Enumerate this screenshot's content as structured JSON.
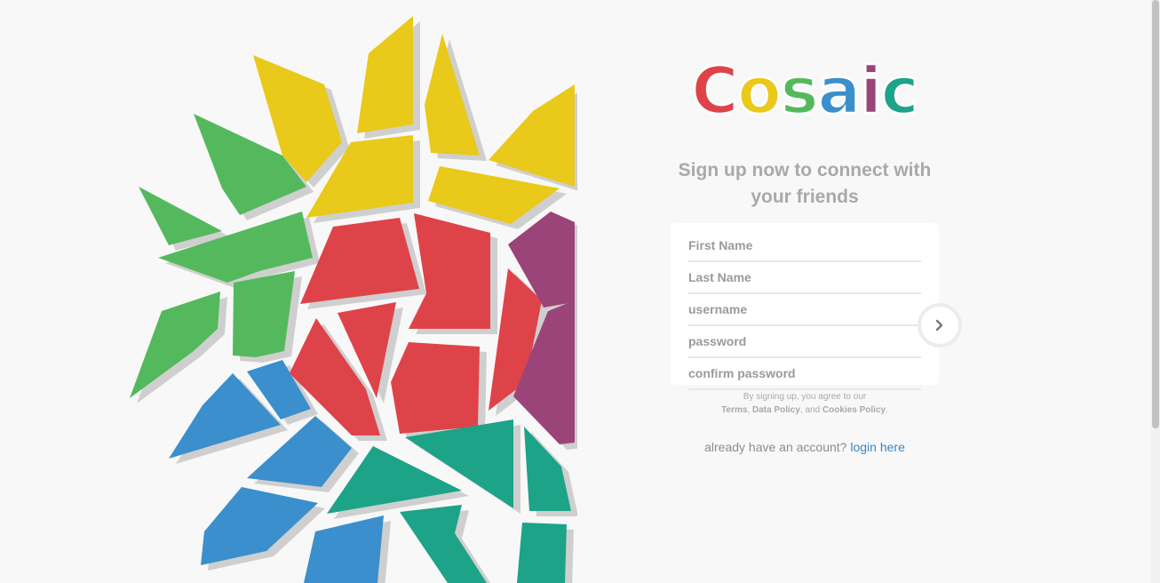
{
  "brand": {
    "name": "Cosaic",
    "letter_colors": [
      "#df434a",
      "#e9c919",
      "#54b95d",
      "#3a8fcc",
      "#9b4479",
      "#1da387"
    ]
  },
  "signup": {
    "tagline_line1": "Sign up now to connect with",
    "tagline_line2": "your friends",
    "fields": {
      "first_name": "First Name",
      "last_name": "Last Name",
      "username": "username",
      "password": "password",
      "confirm_password": "confirm password"
    },
    "submit_icon": "chevron-right-icon",
    "terms": {
      "prefix": "By signing up, you agree to our",
      "terms": "Terms",
      "comma": ", ",
      "data_policy": "Data Policy",
      "and": ", and ",
      "cookies_policy": "Cookies Policy",
      "suffix": "."
    },
    "login_prompt": "already have an account?",
    "login_link": "login here"
  },
  "colors": {
    "red": "#df434a",
    "yellow": "#e9c919",
    "green": "#54b95d",
    "blue": "#3a8fcc",
    "purple": "#9b4479",
    "teal": "#1da387",
    "shadow": "#cfcfcf",
    "link": "#3a87c2"
  }
}
